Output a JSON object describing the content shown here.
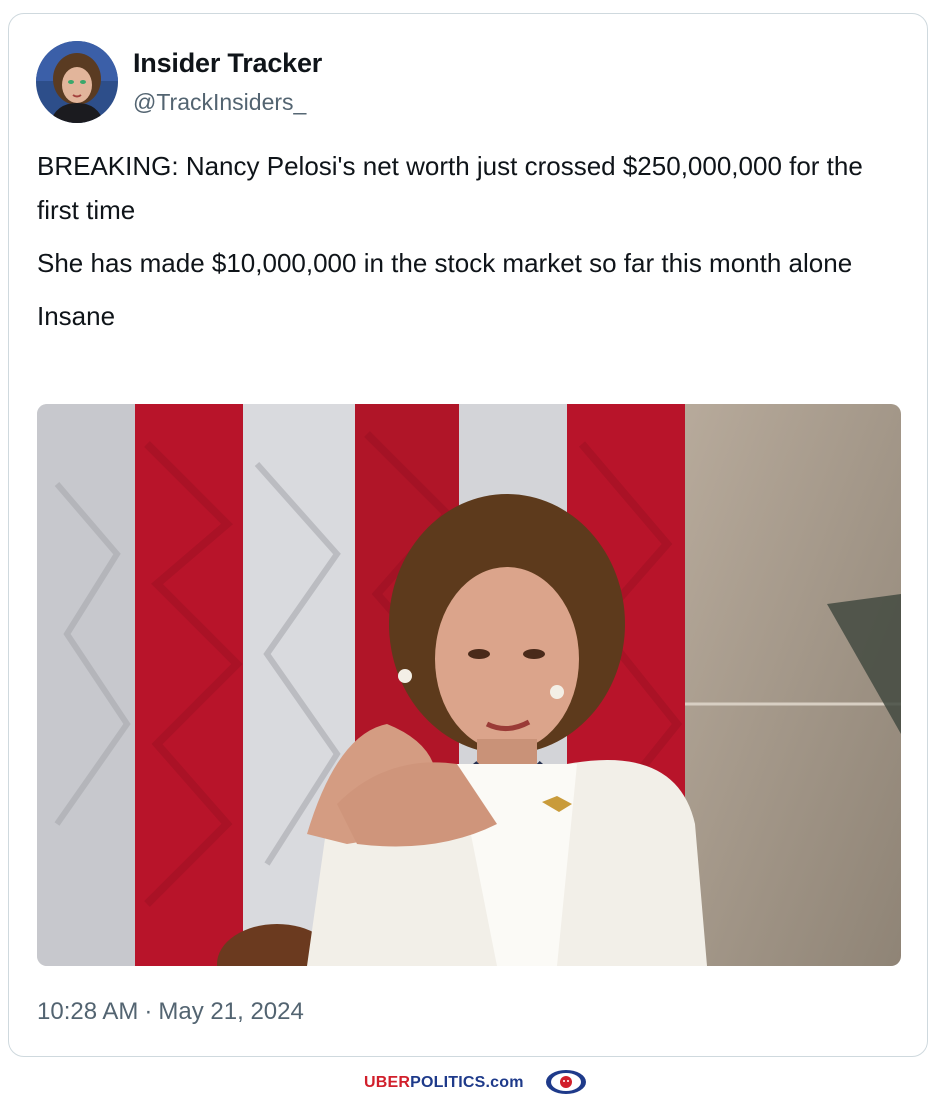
{
  "tweet": {
    "display_name": "Insider Tracker",
    "handle": "@TrackInsiders_",
    "paragraphs": [
      "BREAKING: Nancy Pelosi's net worth just crossed $250,000,000 for the first time",
      "She has made $10,000,000 in the stock market so far this month alone",
      "Insane"
    ],
    "time": "10:28 AM",
    "separator": "·",
    "date": "May 21, 2024"
  },
  "footer": {
    "brand_part1": "UBER",
    "brand_part2": "POLITICS.com"
  },
  "colors": {
    "text": "#0f1419",
    "muted": "#536471",
    "border": "#cfd9de",
    "flag_red": "#b8142a",
    "brand_red": "#d11f2b",
    "brand_blue": "#1e3a8a"
  },
  "icons": {
    "avatar": "avatar-photo",
    "media": "tweet-photo",
    "brand_logo": "lion-emblem-icon"
  }
}
